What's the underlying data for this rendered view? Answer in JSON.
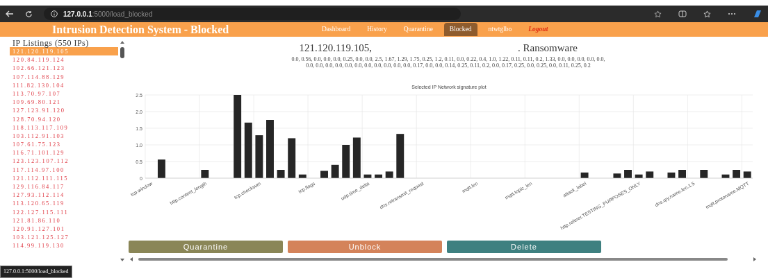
{
  "browser": {
    "url_host": "127.0.0.1",
    "url_path": ":5000/load_blocked"
  },
  "navbar": {
    "title": "Intrusion Detection System - Blocked",
    "links": [
      {
        "label": "Dashboard",
        "selected": false,
        "kind": "link"
      },
      {
        "label": "History",
        "selected": false,
        "kind": "link"
      },
      {
        "label": "Quarantine",
        "selected": false,
        "kind": "link"
      },
      {
        "label": "Blocked",
        "selected": true,
        "kind": "link"
      },
      {
        "label": "ntwtglbo",
        "selected": false,
        "kind": "link"
      },
      {
        "label": "Logout",
        "selected": false,
        "kind": "logout"
      }
    ]
  },
  "sidebar": {
    "heading": "IP Listings (550 IPs)",
    "items": [
      {
        "ip": "121.120.119.105",
        "selected": true
      },
      {
        "ip": "120.84.119.124",
        "selected": false
      },
      {
        "ip": "102.66.121.123",
        "selected": false
      },
      {
        "ip": "107.114.88.129",
        "selected": false
      },
      {
        "ip": "111.82.130.104",
        "selected": false
      },
      {
        "ip": "113.70.97.107",
        "selected": false
      },
      {
        "ip": "109.69.80.121",
        "selected": false
      },
      {
        "ip": "127.123.91.120",
        "selected": false
      },
      {
        "ip": "128.70.94.120",
        "selected": false
      },
      {
        "ip": "118.113.117.109",
        "selected": false
      },
      {
        "ip": "103.112.91.103",
        "selected": false
      },
      {
        "ip": "107.61.75.123",
        "selected": false
      },
      {
        "ip": "116.71.101.129",
        "selected": false
      },
      {
        "ip": "123.123.107.112",
        "selected": false
      },
      {
        "ip": "117.114.97.100",
        "selected": false
      },
      {
        "ip": "121.112.111.115",
        "selected": false
      },
      {
        "ip": "129.116.84.117",
        "selected": false
      },
      {
        "ip": "127.93.112.114",
        "selected": false
      },
      {
        "ip": "113.120.65.119",
        "selected": false
      },
      {
        "ip": "122.127.115.111",
        "selected": false
      },
      {
        "ip": "121.81.86.110",
        "selected": false
      },
      {
        "ip": "120.91.127.101",
        "selected": false
      },
      {
        "ip": "103.121.125.127",
        "selected": false
      },
      {
        "ip": "114.99.119.130",
        "selected": false
      }
    ]
  },
  "detail": {
    "ip": "121.120.119.105,",
    "attack": ". Ransomware",
    "signature_lines": [
      "0.0, 0.56, 0.0, 0.0, 0.0, 0.25, 0.0, 0.0, 2.5, 1.67, 1.29, 1.75, 0.25, 1.2, 0.11, 0.0, 0.22, 0.4, 1.0, 1.22, 0.11, 0.11, 0.2, 1.33, 0.0, 0.0, 0.0, 0.0, 0.0,",
      "0.0, 0.0, 0.0, 0.0, 0.0, 0.0, 0.0, 0.0, 0.0, 0.0, 0.0, 0.17, 0.0, 0.0, 0.14, 0.25, 0.11, 0.2, 0.0, 0.17, 0.25, 0.0, 0.25, 0.0, 0.11, 0.25, 0.2"
    ],
    "chart_data": {
      "type": "bar",
      "title": "Selected IP Network signature plot",
      "categories": [
        "tcp.window",
        null,
        null,
        null,
        null,
        "http.content_length",
        null,
        null,
        null,
        null,
        "tcp.checksum",
        null,
        null,
        null,
        null,
        "tcp.flags",
        null,
        null,
        null,
        null,
        "udp.time_delta",
        null,
        null,
        null,
        null,
        "dns.retransmit_request",
        null,
        null,
        null,
        null,
        "mqtt.len",
        null,
        null,
        null,
        null,
        "mqtt.topic_len",
        null,
        null,
        null,
        null,
        "attack_label",
        null,
        null,
        null,
        null,
        "http.referer.TESTING_PURPOSES_ONLY",
        null,
        null,
        null,
        null,
        "dns.qry.name.len.1.5",
        null,
        null,
        null,
        null,
        "mqtt.protoname.MQTT"
      ],
      "series": [
        {
          "color": "#262626",
          "values": [
            0.0,
            0.56,
            0.0,
            0.0,
            0.0,
            0.25,
            0.0,
            0.0,
            2.5,
            1.67,
            1.29,
            1.75,
            0.25,
            1.2,
            0.11,
            0.0,
            0.22,
            0.4,
            1.0,
            1.22,
            0.11,
            0.11,
            0.2,
            1.33,
            0.0,
            0.0,
            0.0,
            0.0,
            0.0,
            0.0,
            0.0,
            0.0,
            0.0,
            0.0,
            0.0,
            0.0,
            0.0,
            0.0,
            0.0,
            0.0,
            0.17,
            0.0,
            0.0,
            0.14,
            0.25,
            0.11,
            0.2,
            0.0,
            0.17,
            0.25,
            0.0,
            0.25,
            0.0,
            0.11,
            0.25,
            0.2
          ]
        }
      ],
      "ylim": [
        0,
        2.5
      ],
      "grid": true,
      "yticks": [
        0,
        {
          "value": 0.5,
          "label": "0.5"
        },
        {
          "value": 1,
          "label": "1.0"
        },
        {
          "value": 1.5,
          "label": "1.5"
        },
        {
          "value": 2,
          "label": "2.0"
        },
        {
          "value": 2.5,
          "label": "2.5"
        }
      ]
    }
  },
  "buttons": [
    {
      "label": "Quarantine",
      "kind": "quarantine"
    },
    {
      "label": "Unblock",
      "kind": "unblock"
    },
    {
      "label": "Delete",
      "kind": "delete"
    }
  ],
  "status_tooltip": "127.0.0.1:5000/load_blocked"
}
